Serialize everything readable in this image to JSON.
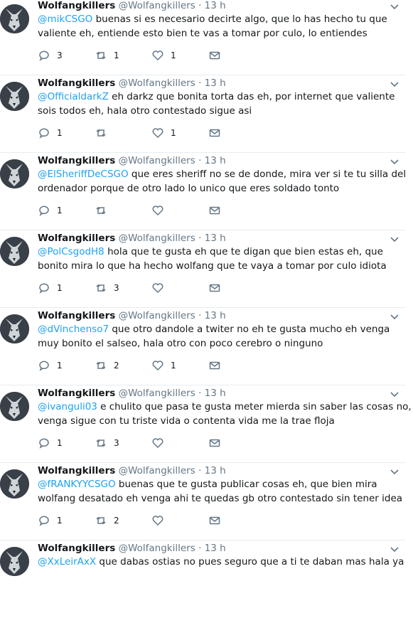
{
  "tweets": [
    {
      "name": "Wolfangkillers",
      "handle": "@Wolfangkillers",
      "time": "· 13 h",
      "mention": "@mikCSGO",
      "line1": " buenas si es necesario decirte algo, que lo has hecho tu que",
      "line2": "valiente eh, entiende esto bien te vas a tomar por culo, lo entiendes",
      "replies": "3",
      "retweets": "1",
      "likes": "1"
    },
    {
      "name": "Wolfangkillers",
      "handle": "@Wolfangkillers",
      "time": "· 13 h",
      "mention": "@OfficialdarkZ",
      "line1": " eh darkz que bonita torta das eh, por internet que valiente",
      "line2": "sois todos eh, hala otro contestado sigue asi",
      "replies": "1",
      "retweets": "",
      "likes": "1"
    },
    {
      "name": "Wolfangkillers",
      "handle": "@Wolfangkillers",
      "time": "· 13 h",
      "mention": "@ElSheriffDeCSGO",
      "line1": " que eres sheriff no se de donde, mira ver si te tu silla del",
      "line2": "ordenador porque de otro lado lo unico que eres soldado tonto",
      "replies": "1",
      "retweets": "",
      "likes": ""
    },
    {
      "name": "Wolfangkillers",
      "handle": "@Wolfangkillers",
      "time": "· 13 h",
      "mention": "@PolCsgodH8",
      "line1": " hola que te gusta eh que te digan que bien estas eh, que",
      "line2": "bonito mira lo que ha hecho wolfang que te vaya a tomar por culo idiota",
      "replies": "1",
      "retweets": "3",
      "likes": ""
    },
    {
      "name": "Wolfangkillers",
      "handle": "@Wolfangkillers",
      "time": "· 13 h",
      "mention": "@dVinchenso7",
      "line1": " que otro dandole a twiter no eh te gusta mucho eh venga",
      "line2": "muy bonito el salseo, hala otro con poco cerebro o ninguno",
      "replies": "1",
      "retweets": "2",
      "likes": "1"
    },
    {
      "name": "Wolfangkillers",
      "handle": "@Wolfangkillers",
      "time": "· 13 h",
      "mention": "@ivanguli03",
      "line1": " e chulito que pasa te gusta meter mierda sin saber las cosas no,",
      "line2": "venga sigue con tu triste vida o contenta vida me la trae floja",
      "replies": "1",
      "retweets": "3",
      "likes": ""
    },
    {
      "name": "Wolfangkillers",
      "handle": "@Wolfangkillers",
      "time": "· 13 h",
      "mention": "@fRANKYYCSGO",
      "line1": " buenas que te gusta publicar cosas eh, que bien mira",
      "line2": "wolfang desatado eh venga ahi te quedas gb otro contestado sin tener idea",
      "replies": "1",
      "retweets": "2",
      "likes": ""
    },
    {
      "name": "Wolfangkillers",
      "handle": "@Wolfangkillers",
      "time": "· 13 h",
      "mention": "@XxLeirAxX",
      "line1": " que dabas ostias no pues seguro que a ti te daban mas hala ya",
      "line2": "",
      "replies": "",
      "retweets": "",
      "likes": ""
    }
  ],
  "icons": {
    "reply": "reply-icon",
    "retweet": "retweet-icon",
    "like": "heart-icon",
    "dm": "envelope-icon",
    "caret": "chevron-down-icon"
  },
  "colors": {
    "mention": "#1da1f2",
    "muted": "#657786",
    "text": "#14171a",
    "divider": "#e6ecf0"
  }
}
